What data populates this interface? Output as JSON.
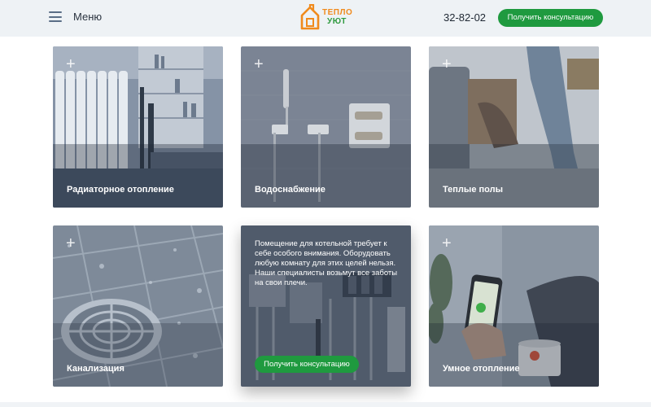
{
  "header": {
    "menu_label": "Меню",
    "logo_line1": "ТЕПЛО",
    "logo_line2": "УЮТ",
    "phone": "32-82-02",
    "cta_label": "Получить консультацию"
  },
  "services": [
    {
      "label": "Радиаторное отопление"
    },
    {
      "label": "Водоснабжение"
    },
    {
      "label": "Теплые полы"
    },
    {
      "label": "Канализация"
    },
    {
      "description": "Помещение для котельной требует к себе особого внимания. Оборудовать любую комнату для этих целей нельзя. Наши специалисты возьмут все заботы на свои плечи.",
      "cta_label": "Получить консультацию"
    },
    {
      "label": "Умное отопление"
    }
  ],
  "plus_glyph": "+",
  "colors": {
    "accent_green": "#1f9a3f",
    "logo_orange": "#f08a1c",
    "logo_green": "#2e9a3e",
    "header_bg": "#eef2f5"
  }
}
